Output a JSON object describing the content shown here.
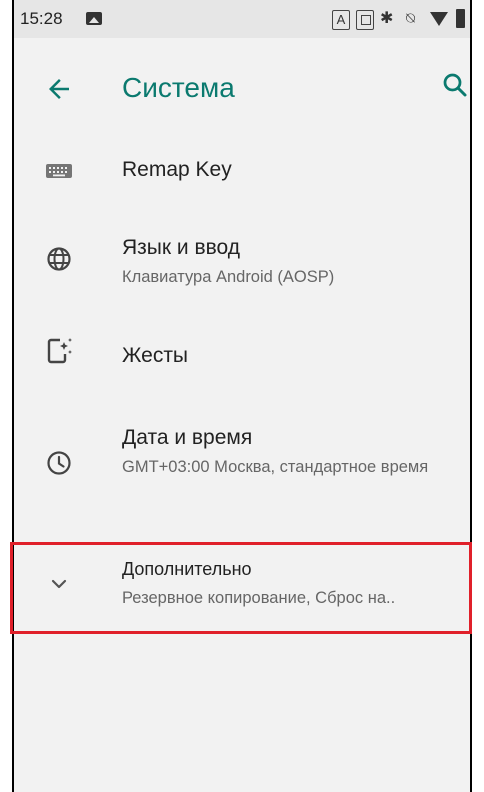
{
  "status_bar": {
    "time": "15:28",
    "a_badge": "A"
  },
  "app_bar": {
    "title": "Система",
    "accent_color": "#0b7a6f"
  },
  "settings": [
    {
      "key": "remap",
      "icon": "keyboard-icon",
      "title": "Remap Key",
      "summary": ""
    },
    {
      "key": "language",
      "icon": "globe-icon",
      "title": "Язык и ввод",
      "summary": "Клавиатура Android (AOSP)"
    },
    {
      "key": "gestures",
      "icon": "gestures-phone-icon",
      "title": "Жесты",
      "summary": ""
    },
    {
      "key": "datetime",
      "icon": "clock-icon",
      "title": "Дата и время",
      "summary": "GMT+03:00 Москва, стандартное время"
    },
    {
      "key": "advanced",
      "icon": "chevron-down-icon",
      "title": "Дополнительно",
      "summary": "Резервное копирование, Сброс на.."
    }
  ],
  "highlight_color": "#e0202a"
}
